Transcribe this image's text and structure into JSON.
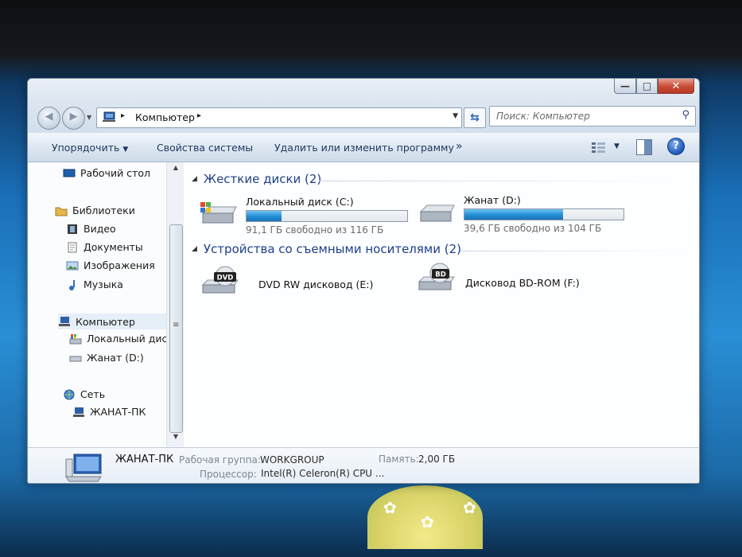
{
  "window": {
    "caption": {
      "minimize": "—",
      "maximize": "□",
      "close": "✕"
    }
  },
  "navigation": {
    "back_icon": "back-arrow-icon",
    "forward_icon": "forward-arrow-icon",
    "address_path": "Компьютер",
    "search_placeholder": "Поиск: Компьютер"
  },
  "toolbar": {
    "organize": "Упорядочить",
    "system_properties": "Свойства системы",
    "uninstall": "Удалить или изменить программу",
    "more": "»"
  },
  "sidebar": {
    "items": [
      {
        "label": "Рабочий стол",
        "icon": "desktop-icon"
      },
      {
        "label": "Библиотеки",
        "icon": "libraries-icon"
      },
      {
        "label": "Видео",
        "icon": "video-icon"
      },
      {
        "label": "Документы",
        "icon": "documents-icon"
      },
      {
        "label": "Изображения",
        "icon": "pictures-icon"
      },
      {
        "label": "Музыка",
        "icon": "music-icon"
      },
      {
        "label": "Компьютер",
        "icon": "computer-icon"
      },
      {
        "label": "Локальный диск",
        "icon": "local-disk-icon"
      },
      {
        "label": "Жанат (D:)",
        "icon": "drive-icon"
      },
      {
        "label": "Сеть",
        "icon": "network-icon"
      },
      {
        "label": "ЖАНАТ-ПК",
        "icon": "pc-icon"
      }
    ]
  },
  "content": {
    "hard_disks_header": "Жесткие диски (2)",
    "removable_header": "Устройства со съемными носителями (2)",
    "hard_disks": [
      {
        "name": "Локальный диск (C:)",
        "free_text": "91,1 ГБ свободно из 116 ГБ",
        "used_fraction": 0.22
      },
      {
        "name": "Жанат (D:)",
        "free_text": "39,6 ГБ свободно из 104 ГБ",
        "used_fraction": 0.62
      }
    ],
    "removable": [
      {
        "name": "DVD RW дисковод (E:)",
        "badge": "DVD"
      },
      {
        "name": "Дисковод BD-ROM (F:)",
        "badge": "BD"
      }
    ]
  },
  "details": {
    "computer_name": "ЖАНАТ-ПК",
    "workgroup_label": "Рабочая группа:",
    "workgroup_value": "WORKGROUP",
    "memory_label": "Память:",
    "memory_value": "2,00 ГБ",
    "cpu_label": "Процессор:",
    "cpu_value": "Intel(R) Celeron(R) CPU ..."
  },
  "colors": {
    "accent": "#1e3f8a",
    "bar_fill": "#1f8ed6",
    "close_button": "#c74a35"
  }
}
